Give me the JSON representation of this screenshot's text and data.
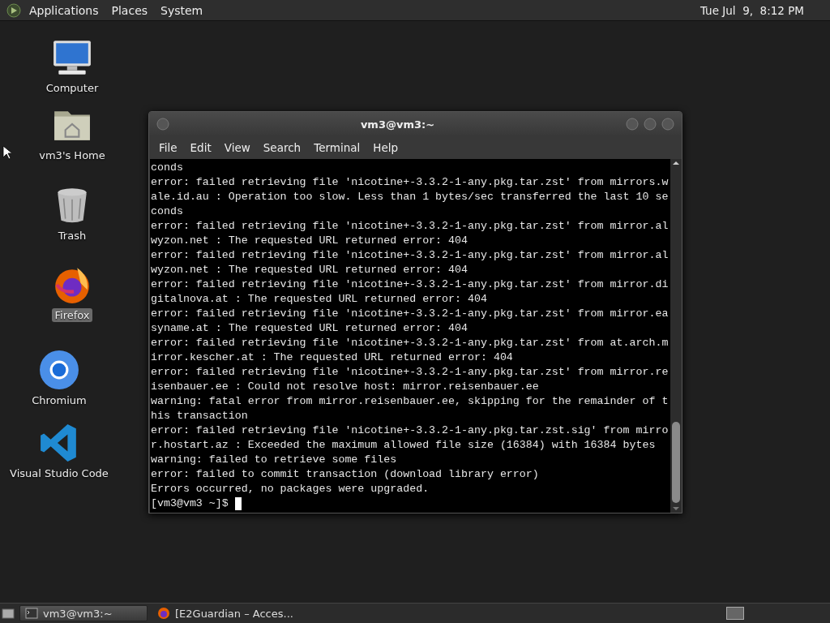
{
  "top_panel": {
    "menus": [
      "Applications",
      "Places",
      "System"
    ],
    "clock": "Tue Jul  9,  8:12 PM"
  },
  "desktop_icons": [
    {
      "kind": "computer",
      "label": "Computer",
      "selected": false
    },
    {
      "kind": "home",
      "label": "vm3's Home",
      "selected": false
    },
    {
      "kind": "trash",
      "label": "Trash",
      "selected": false
    },
    {
      "kind": "firefox",
      "label": "Firefox",
      "selected": true
    },
    {
      "kind": "chromium",
      "label": "Chromium",
      "selected": false
    },
    {
      "kind": "vscode",
      "label": "Visual Studio Code",
      "selected": false
    }
  ],
  "terminal": {
    "title": "vm3@vm3:~",
    "menu": [
      "File",
      "Edit",
      "View",
      "Search",
      "Terminal",
      "Help"
    ],
    "lines": [
      "conds",
      "error: failed retrieving file 'nicotine+-3.3.2-1-any.pkg.tar.zst' from mirrors.w",
      "ale.id.au : Operation too slow. Less than 1 bytes/sec transferred the last 10 se",
      "conds",
      "error: failed retrieving file 'nicotine+-3.3.2-1-any.pkg.tar.zst' from mirror.al",
      "wyzon.net : The requested URL returned error: 404",
      "error: failed retrieving file 'nicotine+-3.3.2-1-any.pkg.tar.zst' from mirror.al",
      "wyzon.net : The requested URL returned error: 404",
      "error: failed retrieving file 'nicotine+-3.3.2-1-any.pkg.tar.zst' from mirror.di",
      "gitalnova.at : The requested URL returned error: 404",
      "error: failed retrieving file 'nicotine+-3.3.2-1-any.pkg.tar.zst' from mirror.ea",
      "syname.at : The requested URL returned error: 404",
      "error: failed retrieving file 'nicotine+-3.3.2-1-any.pkg.tar.zst' from at.arch.m",
      "irror.kescher.at : The requested URL returned error: 404",
      "error: failed retrieving file 'nicotine+-3.3.2-1-any.pkg.tar.zst' from mirror.re",
      "isenbauer.ee : Could not resolve host: mirror.reisenbauer.ee",
      "warning: fatal error from mirror.reisenbauer.ee, skipping for the remainder of t",
      "his transaction",
      "error: failed retrieving file 'nicotine+-3.3.2-1-any.pkg.tar.zst.sig' from mirro",
      "r.hostart.az : Exceeded the maximum allowed file size (16384) with 16384 bytes",
      "warning: failed to retrieve some files",
      "error: failed to commit transaction (download library error)",
      "Errors occurred, no packages were upgraded."
    ],
    "prompt": "[vm3@vm3 ~]$"
  },
  "taskbar": {
    "tasks": [
      {
        "kind": "terminal",
        "label": "vm3@vm3:~",
        "selected": true
      },
      {
        "kind": "firefox",
        "label": "[E2Guardian – Acces...",
        "selected": false
      }
    ]
  }
}
